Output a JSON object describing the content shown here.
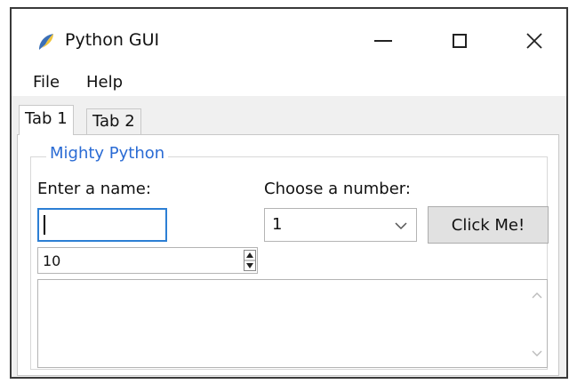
{
  "window": {
    "title": "Python GUI",
    "icon": "python-feather-icon"
  },
  "menu": {
    "items": [
      "File",
      "Help"
    ]
  },
  "tabs": [
    {
      "label": "Tab 1",
      "active": true
    },
    {
      "label": "Tab 2",
      "active": false
    }
  ],
  "group": {
    "title": "Mighty Python",
    "title_color": "#2a6bd4"
  },
  "form": {
    "name_label": "Enter a name:",
    "name_value": "",
    "number_label": "Choose a number:",
    "number_value": "1",
    "button_label": "Click Me!",
    "spin_value": "10",
    "scrolled_text_value": ""
  },
  "colors": {
    "focus_border": "#2c7fd4",
    "button_bg": "#e1e1e1"
  }
}
